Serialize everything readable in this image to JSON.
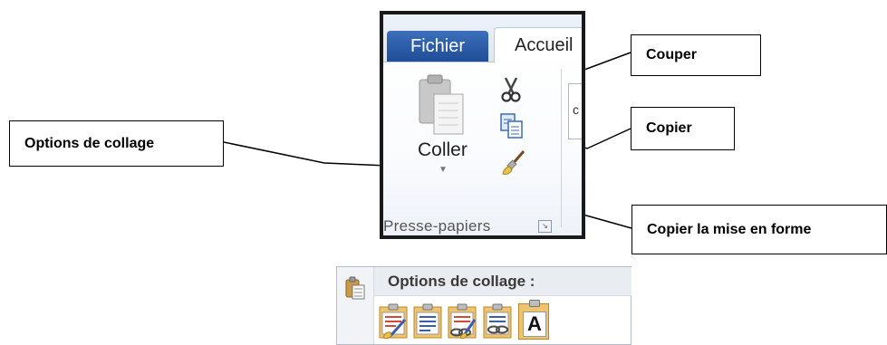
{
  "ribbon": {
    "tabs": [
      "Fichier",
      "Accueil"
    ],
    "paste_label": "Coller",
    "group_label": "Presse-papiers",
    "next_group_char": "c"
  },
  "callouts": {
    "couper": "Couper",
    "copier": "Copier",
    "copier_mise_en_forme": "Copier la mise en forme",
    "options_collage": "Options de collage"
  },
  "paste_menu": {
    "header": "Options de collage :",
    "options": [
      "keep-source-formatting-icon",
      "merge-formatting-icon",
      "link-keep-source-icon",
      "link-merge-icon",
      "keep-text-only-icon"
    ],
    "text_only_glyph": "A"
  },
  "colors": {
    "file_tab": "#2b5aa7",
    "callout_border": "#000000",
    "arrow": "#000000"
  }
}
